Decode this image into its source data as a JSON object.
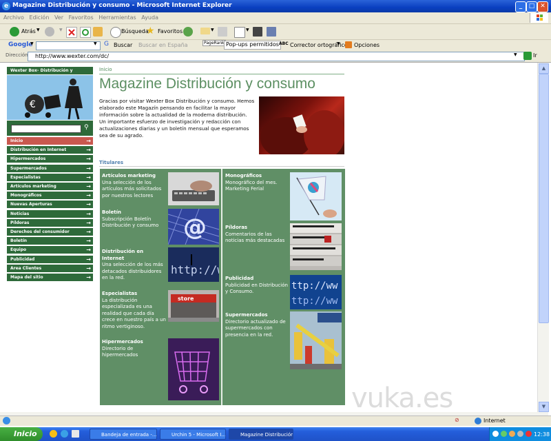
{
  "window": {
    "title": "Magazine Distribución y consumo - Microsoft Internet Explorer",
    "controls": {
      "minimize": "_",
      "maximize": "□",
      "close": "✕"
    }
  },
  "menu": [
    "Archivo",
    "Edición",
    "Ver",
    "Favoritos",
    "Herramientas",
    "Ayuda"
  ],
  "toolbar": {
    "back": "Atrás",
    "search": "Búsqueda",
    "favorites": "Favoritos"
  },
  "googlebar": {
    "logo": "Google",
    "search_btn": "Buscar",
    "search_spain": "Buscar en España",
    "pagerank": "PageRank",
    "popups": "Pop-ups permitidos",
    "spell": "Corrector ortográfico",
    "options": "Opciones"
  },
  "address": {
    "label": "Dirección",
    "url": "http://www.wexter.com/dc/",
    "go": "Ir"
  },
  "nav": {
    "header": "Wexter Box- Distribución y consumo",
    "items": [
      {
        "label": "Inicio",
        "active": true
      },
      {
        "label": "Distribución en Internet"
      },
      {
        "label": "Hipermercados"
      },
      {
        "label": "Supermercados"
      },
      {
        "label": "Especialistas"
      },
      {
        "label": "Artículos marketing"
      },
      {
        "label": "Monográficos"
      },
      {
        "label": "Nuevas Aperturas"
      },
      {
        "label": "Noticias"
      },
      {
        "label": "Píldoras"
      },
      {
        "label": "Derechos del consumidor"
      },
      {
        "label": "Boletín"
      },
      {
        "label": "Equipo"
      },
      {
        "label": "Publicidad"
      },
      {
        "label": "Area Clientes"
      },
      {
        "label": "Mapa del sitio"
      }
    ]
  },
  "main": {
    "breadcrumb": "Inicio",
    "title": "Magazine Distribución y consumo",
    "intro_p1": "Gracias por visitar Wexter Box Distribución y consumo. Hemos elaborado este Magazín pensando en facilitar la mayor información sobre la actualidad de la moderna distribución.",
    "intro_p2": "Un importante esfuerzo de investigación y redacción con actualizaciones diarias y un boletín mensual que esperamos sea de su agrado.",
    "section": "Titulares",
    "left_cards": [
      {
        "title": "Artículos marketing",
        "text": "Una selección de los artículos más solicitados por nuestros lectores"
      },
      {
        "title": "Boletín",
        "text": "Subscripción Boletín Distribución y consumo"
      },
      {
        "title": "Distribución en Internet",
        "text": "Una selección de los más detacados distribuidores en la red."
      },
      {
        "title": "Especialistas",
        "text": "La distribución especializada es una realidad que cada día crece en nuestro país a un ritmo vertiginoso."
      },
      {
        "title": "Hipermercados",
        "text": "Directorio de hipermercados"
      }
    ],
    "right_cards": [
      {
        "title": "Monográficos",
        "text": "Monográfico del mes. Marketing Ferial"
      },
      {
        "title": "Píldoras",
        "text": "Comentarios de las noticias más destacadas"
      },
      {
        "title": "Publicidad",
        "text": "Publicidad en Distribución y Consumo."
      },
      {
        "title": "Supermercados",
        "text": "Directorio actualizado de supermercados con presencia en la red."
      }
    ]
  },
  "statusbar": {
    "zone": "Internet"
  },
  "taskbar": {
    "start": "Inicio",
    "tasks": [
      "Bandeja de entrada -...",
      "Urchin 5 - Microsoft I...",
      "Magazine Distribución..."
    ],
    "clock": "12:38"
  },
  "watermark": "vuka.es"
}
